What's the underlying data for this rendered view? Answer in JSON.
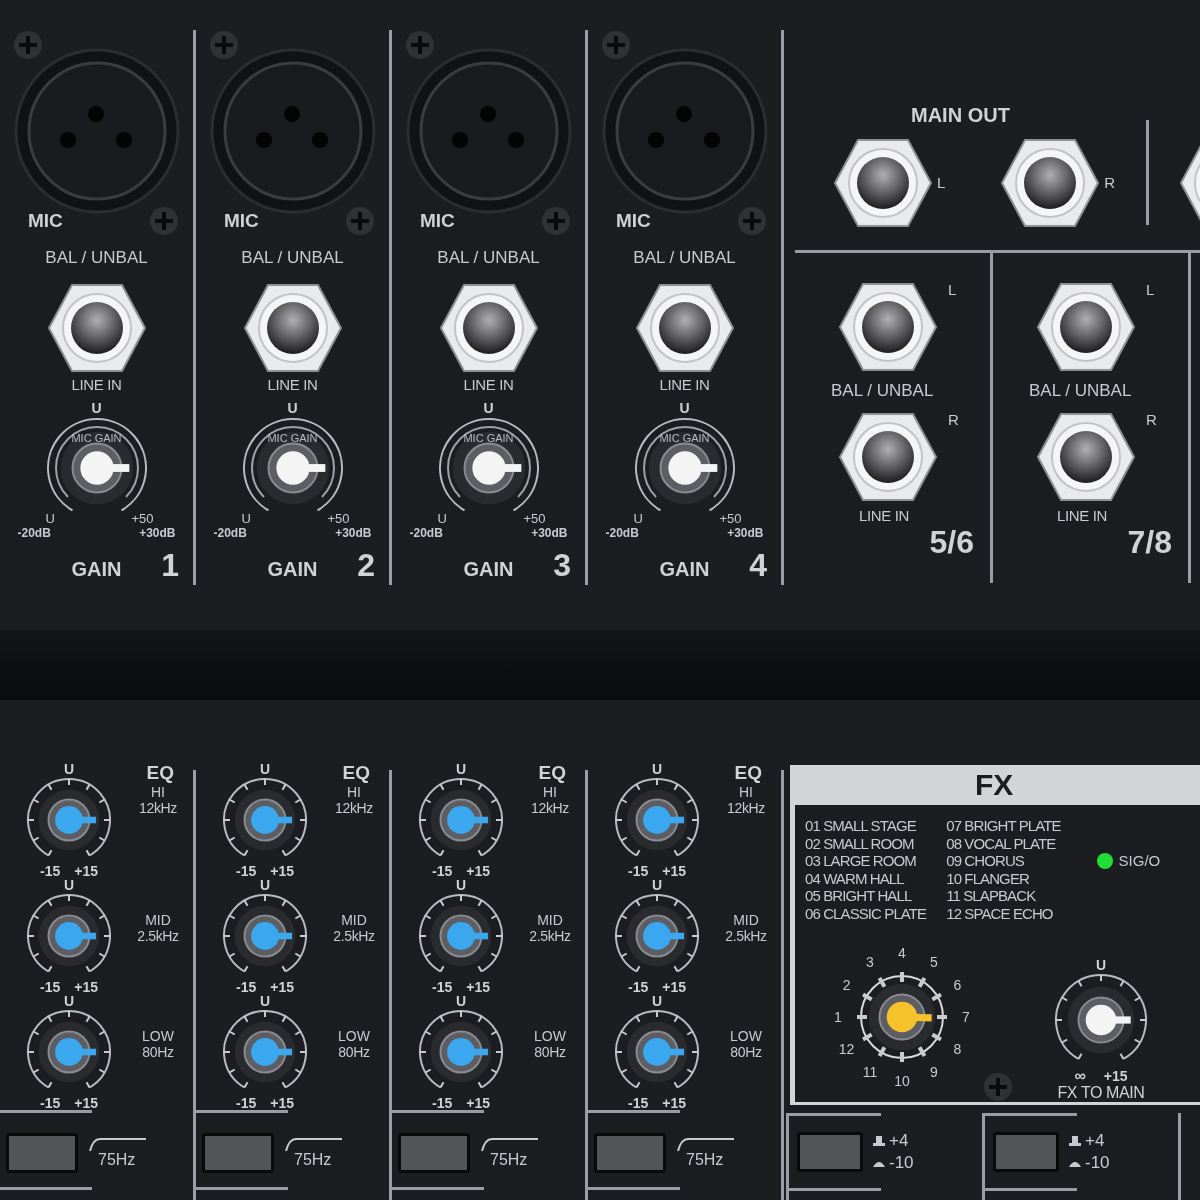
{
  "input_channels": [
    {
      "xlr_label": "MIC",
      "jack_label": "BAL / UNBAL",
      "line_label": "LINE IN",
      "gain": {
        "top": "U",
        "arc_label": "MIC GAIN",
        "inner_min": "U",
        "inner_max": "+50",
        "outer_min": "-20dB",
        "outer_max": "+30dB",
        "label": "GAIN"
      },
      "number": "1"
    },
    {
      "xlr_label": "MIC",
      "jack_label": "BAL / UNBAL",
      "line_label": "LINE IN",
      "gain": {
        "top": "U",
        "arc_label": "MIC GAIN",
        "inner_min": "U",
        "inner_max": "+50",
        "outer_min": "-20dB",
        "outer_max": "+30dB",
        "label": "GAIN"
      },
      "number": "2"
    },
    {
      "xlr_label": "MIC",
      "jack_label": "BAL / UNBAL",
      "line_label": "LINE IN",
      "gain": {
        "top": "U",
        "arc_label": "MIC GAIN",
        "inner_min": "U",
        "inner_max": "+50",
        "outer_min": "-20dB",
        "outer_max": "+30dB",
        "label": "GAIN"
      },
      "number": "3"
    },
    {
      "xlr_label": "MIC",
      "jack_label": "BAL / UNBAL",
      "line_label": "LINE IN",
      "gain": {
        "top": "U",
        "arc_label": "MIC GAIN",
        "inner_min": "U",
        "inner_max": "+50",
        "outer_min": "-20dB",
        "outer_max": "+30dB",
        "label": "GAIN"
      },
      "number": "4"
    }
  ],
  "main_out": {
    "label": "MAIN OUT",
    "jacks": [
      {
        "side": "L"
      },
      {
        "side": "R"
      }
    ]
  },
  "stereo_channels": [
    {
      "jacks": [
        {
          "side": "L"
        },
        {
          "side": "R"
        }
      ],
      "jack_label": "BAL / UNBAL",
      "line_label": "LINE IN",
      "number": "5/6"
    },
    {
      "jacks": [
        {
          "side": "L"
        },
        {
          "side": "R"
        }
      ],
      "jack_label": "BAL / UNBAL",
      "line_label": "LINE IN",
      "number": "7/8"
    }
  ],
  "eq_channels": [
    {
      "title": "EQ",
      "bands": [
        {
          "center": "U",
          "name": "HI",
          "freq": "12kHz",
          "min": "-15",
          "max": "+15"
        },
        {
          "center": "U",
          "name": "MID",
          "freq": "2.5kHz",
          "min": "-15",
          "max": "+15"
        },
        {
          "center": "U",
          "name": "LOW",
          "freq": "80Hz",
          "min": "-15",
          "max": "+15"
        }
      ],
      "filter": "75Hz",
      "filter_pressed": false
    },
    {
      "title": "EQ",
      "bands": [
        {
          "center": "U",
          "name": "HI",
          "freq": "12kHz",
          "min": "-15",
          "max": "+15"
        },
        {
          "center": "U",
          "name": "MID",
          "freq": "2.5kHz",
          "min": "-15",
          "max": "+15"
        },
        {
          "center": "U",
          "name": "LOW",
          "freq": "80Hz",
          "min": "-15",
          "max": "+15"
        }
      ],
      "filter": "75Hz",
      "filter_pressed": false
    },
    {
      "title": "EQ",
      "bands": [
        {
          "center": "U",
          "name": "HI",
          "freq": "12kHz",
          "min": "-15",
          "max": "+15"
        },
        {
          "center": "U",
          "name": "MID",
          "freq": "2.5kHz",
          "min": "-15",
          "max": "+15"
        },
        {
          "center": "U",
          "name": "LOW",
          "freq": "80Hz",
          "min": "-15",
          "max": "+15"
        }
      ],
      "filter": "75Hz",
      "filter_pressed": false
    },
    {
      "title": "EQ",
      "bands": [
        {
          "center": "U",
          "name": "HI",
          "freq": "12kHz",
          "min": "-15",
          "max": "+15"
        },
        {
          "center": "U",
          "name": "MID",
          "freq": "2.5kHz",
          "min": "-15",
          "max": "+15"
        },
        {
          "center": "U",
          "name": "LOW",
          "freq": "80Hz",
          "min": "-15",
          "max": "+15"
        }
      ],
      "filter": "75Hz",
      "filter_pressed": false
    }
  ],
  "fx": {
    "title": "FX",
    "presets": [
      "01 SMALL STAGE",
      "02 SMALL ROOM",
      "03 LARGE ROOM",
      "04 WARM HALL",
      "05 BRIGHT HALL",
      "06 CLASSIC PLATE",
      "07 BRIGHT PLATE",
      "08 VOCAL PLATE",
      "09 CHORUS",
      "10 FLANGER",
      "11 SLAPBACK",
      "12 SPACE ECHO"
    ],
    "indicator": {
      "label": "SIG/O",
      "on": true
    },
    "selector": {
      "marks": [
        "1",
        "2",
        "3",
        "4",
        "5",
        "6",
        "7",
        "8",
        "9",
        "10",
        "11",
        "12"
      ]
    },
    "return": {
      "top": "U",
      "min": "∞",
      "max": "+15",
      "label": "FX TO MAIN"
    },
    "pads": [
      {
        "high": "+4",
        "low": "-10",
        "pressed": false
      },
      {
        "high": "+4",
        "low": "-10",
        "pressed": false
      }
    ]
  }
}
